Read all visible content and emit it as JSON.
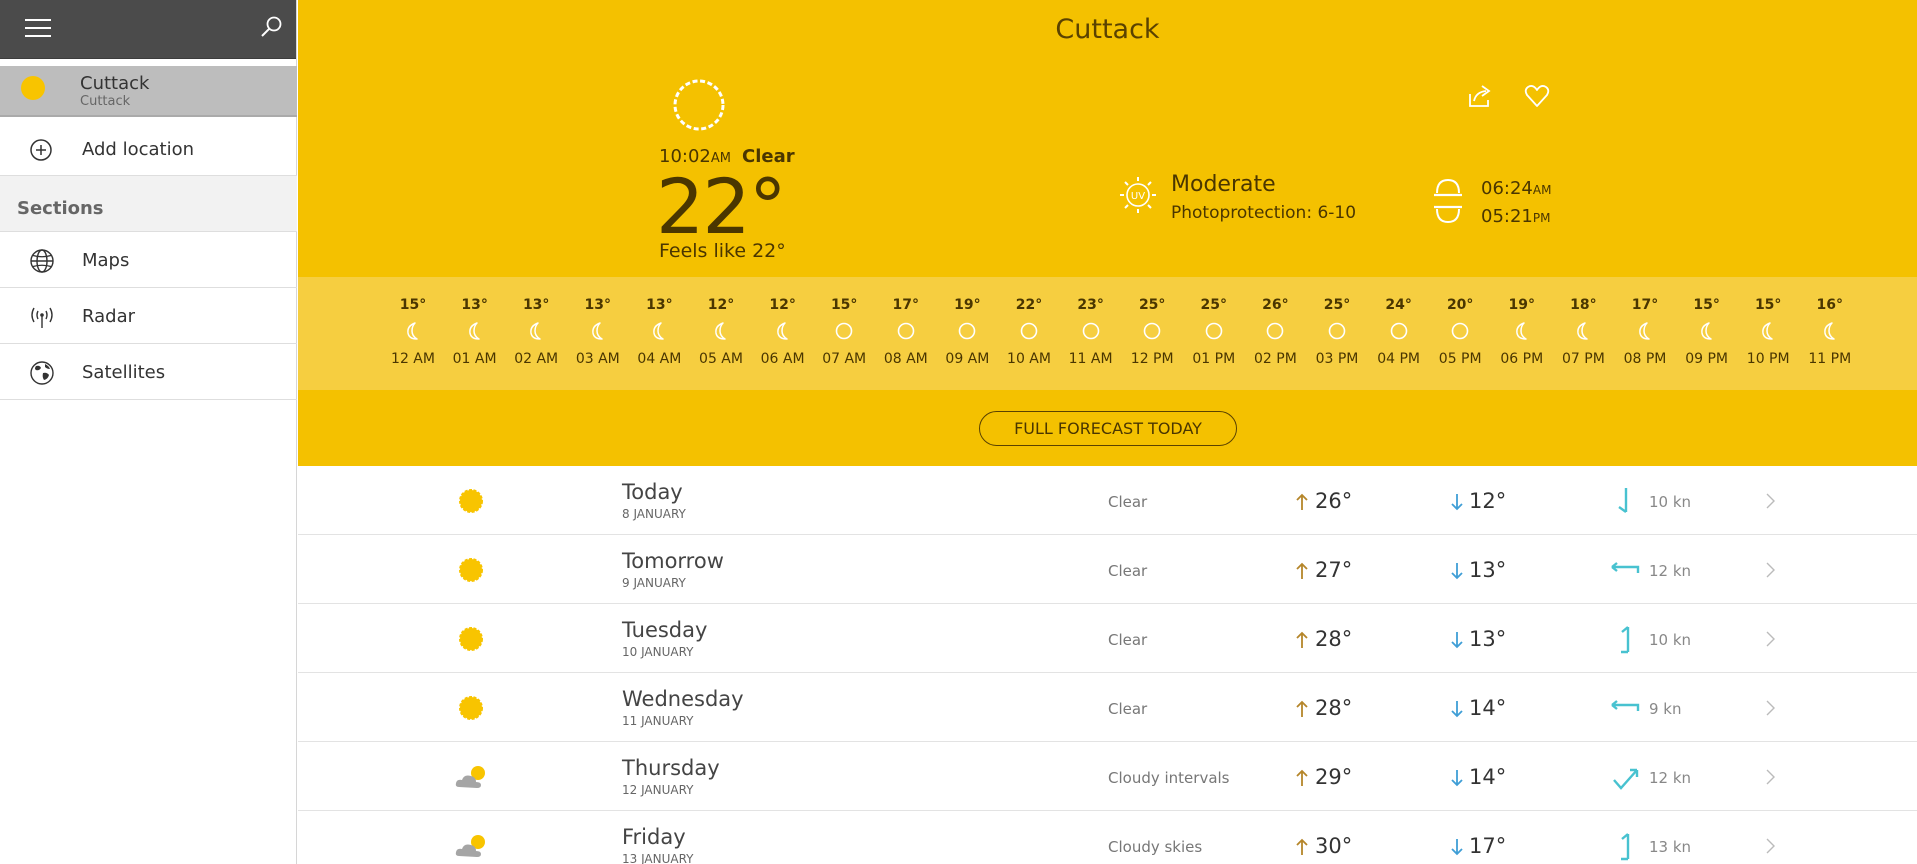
{
  "sidebar": {
    "current_location": {
      "name": "Cuttack",
      "sub": "Cuttack"
    },
    "add_location": "Add location",
    "sections_title": "Sections",
    "items": [
      {
        "label": "Maps",
        "icon": "globe-icon"
      },
      {
        "label": "Radar",
        "icon": "radar-icon"
      },
      {
        "label": "Satellites",
        "icon": "satellite-globe-icon"
      }
    ]
  },
  "header": {
    "city": "Cuttack",
    "time": "10:02",
    "time_suffix": "AM",
    "condition": "Clear",
    "temperature": "22°",
    "feels_like": "Feels like 22°",
    "uv_badge": "UV",
    "uv_level": "Moderate",
    "uv_desc": "Photoprotection: 6-10",
    "sunrise": "06:24",
    "sunrise_suffix": "AM",
    "sunset": "05:21",
    "sunset_suffix": "PM"
  },
  "hourly": [
    {
      "temp": "15°",
      "label": "12 AM",
      "icon": "moon"
    },
    {
      "temp": "13°",
      "label": "01 AM",
      "icon": "moon"
    },
    {
      "temp": "13°",
      "label": "02 AM",
      "icon": "moon"
    },
    {
      "temp": "13°",
      "label": "03 AM",
      "icon": "moon"
    },
    {
      "temp": "13°",
      "label": "04 AM",
      "icon": "moon"
    },
    {
      "temp": "12°",
      "label": "05 AM",
      "icon": "moon"
    },
    {
      "temp": "12°",
      "label": "06 AM",
      "icon": "moon"
    },
    {
      "temp": "15°",
      "label": "07 AM",
      "icon": "sun"
    },
    {
      "temp": "17°",
      "label": "08 AM",
      "icon": "sun"
    },
    {
      "temp": "19°",
      "label": "09 AM",
      "icon": "sun"
    },
    {
      "temp": "22°",
      "label": "10 AM",
      "icon": "sun"
    },
    {
      "temp": "23°",
      "label": "11 AM",
      "icon": "sun"
    },
    {
      "temp": "25°",
      "label": "12 PM",
      "icon": "sun"
    },
    {
      "temp": "25°",
      "label": "01 PM",
      "icon": "sun"
    },
    {
      "temp": "26°",
      "label": "02 PM",
      "icon": "sun"
    },
    {
      "temp": "25°",
      "label": "03 PM",
      "icon": "sun"
    },
    {
      "temp": "24°",
      "label": "04 PM",
      "icon": "sun"
    },
    {
      "temp": "20°",
      "label": "05 PM",
      "icon": "sun"
    },
    {
      "temp": "19°",
      "label": "06 PM",
      "icon": "moon"
    },
    {
      "temp": "18°",
      "label": "07 PM",
      "icon": "moon"
    },
    {
      "temp": "17°",
      "label": "08 PM",
      "icon": "moon"
    },
    {
      "temp": "15°",
      "label": "09 PM",
      "icon": "moon"
    },
    {
      "temp": "15°",
      "label": "10 PM",
      "icon": "moon"
    },
    {
      "temp": "16°",
      "label": "11 PM",
      "icon": "moon"
    }
  ],
  "forecast_button": "FULL FORECAST TODAY",
  "days": [
    {
      "name": "Today",
      "date": "8 JANUARY",
      "condition": "Clear",
      "high": "26°",
      "low": "12°",
      "wind": "10 kn",
      "icon": "sun",
      "wind_icon": "wind-south-icon"
    },
    {
      "name": "Tomorrow",
      "date": "9 JANUARY",
      "condition": "Clear",
      "high": "27°",
      "low": "13°",
      "wind": "12 kn",
      "icon": "sun",
      "wind_icon": "wind-west-icon"
    },
    {
      "name": "Tuesday",
      "date": "10 JANUARY",
      "condition": "Clear",
      "high": "28°",
      "low": "13°",
      "wind": "10 kn",
      "icon": "sun",
      "wind_icon": "wind-north-icon"
    },
    {
      "name": "Wednesday",
      "date": "11 JANUARY",
      "condition": "Clear",
      "high": "28°",
      "low": "14°",
      "wind": "9 kn",
      "icon": "sun",
      "wind_icon": "wind-west-icon"
    },
    {
      "name": "Thursday",
      "date": "12 JANUARY",
      "condition": "Cloudy intervals",
      "high": "29°",
      "low": "14°",
      "wind": "12 kn",
      "icon": "cloud-sun",
      "wind_icon": "wind-northeast-icon"
    },
    {
      "name": "Friday",
      "date": "13 JANUARY",
      "condition": "Cloudy skies",
      "high": "30°",
      "low": "17°",
      "wind": "13 kn",
      "icon": "cloud-sun",
      "wind_icon": "wind-north-icon"
    }
  ],
  "colors": {
    "hero": "#f4c100",
    "hourly_band": "#f6ce40",
    "sidebar_top": "#4b4b4b",
    "selected_location": "#bdbdbd",
    "sun": "#f8c400",
    "temp_up_arrow": "#b5862a",
    "temp_down_arrow": "#3f9ed6",
    "wind_arrow": "#48c2d0"
  }
}
